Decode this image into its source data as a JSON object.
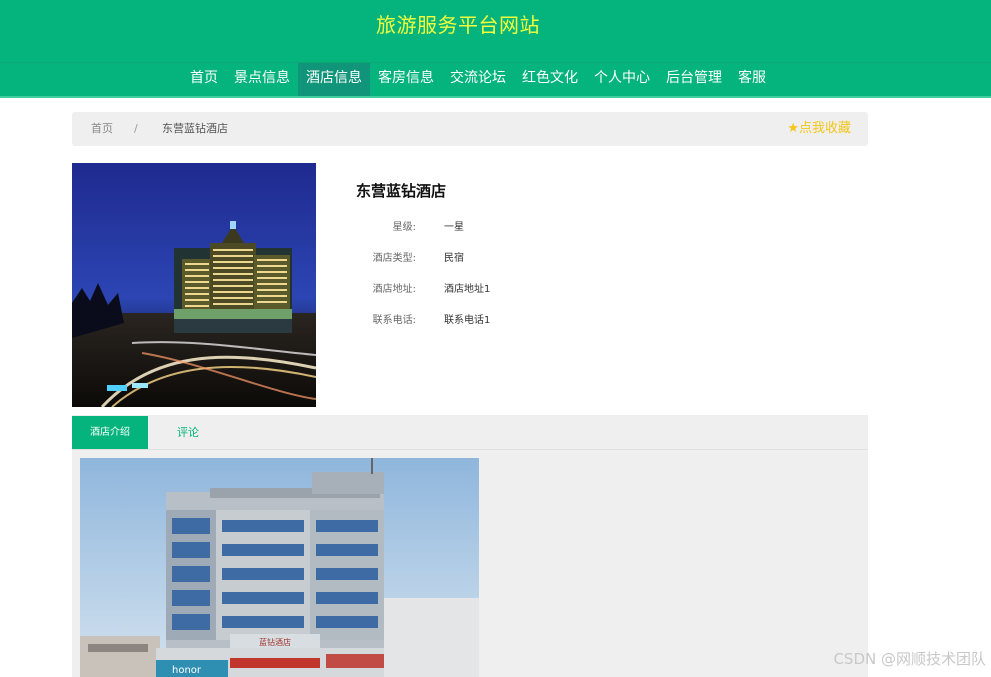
{
  "site": {
    "title": "旅游服务平台网站"
  },
  "nav": {
    "items": [
      {
        "label": "首页"
      },
      {
        "label": "景点信息"
      },
      {
        "label": "酒店信息",
        "active": true
      },
      {
        "label": "客房信息"
      },
      {
        "label": "交流论坛"
      },
      {
        "label": "红色文化"
      },
      {
        "label": "个人中心"
      },
      {
        "label": "后台管理"
      },
      {
        "label": "客服"
      }
    ]
  },
  "breadcrumb": {
    "home": "首页",
    "separator": "/",
    "current": "东营蓝钻酒店",
    "favorite_label": "点我收藏"
  },
  "hotel": {
    "name": "东营蓝钻酒店",
    "fields": [
      {
        "label": "星级:",
        "value": "一星"
      },
      {
        "label": "酒店类型:",
        "value": "民宿"
      },
      {
        "label": "酒店地址:",
        "value": "酒店地址1"
      },
      {
        "label": "联系电话:",
        "value": "联系电话1"
      }
    ]
  },
  "tabs": {
    "intro": "酒店介绍",
    "comment": "评论"
  },
  "intro_photo": {
    "sign_text": "蓝钻酒店",
    "shop_text": "honor"
  },
  "watermark": "CSDN @网顺技术团队",
  "colors": {
    "brand": "#04b47c",
    "title": "#f2ff3c",
    "favorite": "#f5c518"
  }
}
